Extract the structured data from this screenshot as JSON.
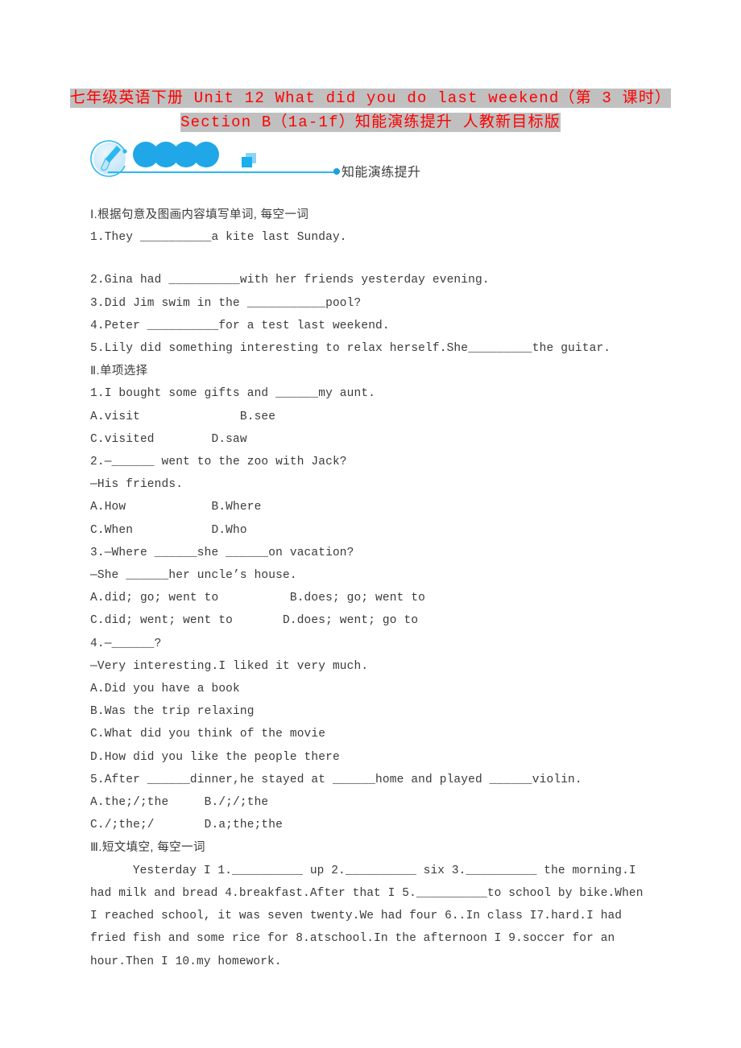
{
  "title": {
    "line1": "七年级英语下册 Unit 12 What did you do last weekend（第 3 课时）",
    "line2": "Section B（1a-1f）知能演练提升 人教新目标版"
  },
  "banner": {
    "label": "知能演练提升",
    "accent_color": "#1fa7e8",
    "logo_icon": "brush-in-circle-icon"
  },
  "sections": [
    {
      "heading": "Ⅰ.根据句意及图画内容填写单词, 每空一词",
      "items": [
        "1.They __________a kite last Sunday.",
        "2.Gina had __________with her friends yesterday evening.",
        "3.Did Jim swim in the ___________pool?",
        "4.Peter __________for a test last weekend.",
        "5.Lily did something interesting to relax herself.She_________the guitar."
      ]
    },
    {
      "heading": "Ⅱ.单项选择",
      "items": [
        "1.I bought some gifts and ______my aunt.",
        "A.visit              B.see",
        "C.visited        D.saw",
        "2.—______ went to the zoo with Jack?",
        "—His friends.",
        "A.How            B.Where",
        "C.When           D.Who",
        "3.—Where ______she ______on vacation?",
        "—She ______her uncle’s house.",
        "A.did; go; went to          B.does; go; went to",
        "C.did; went; went to       D.does; went; go to",
        "4.—______?",
        "—Very interesting.I liked it very much.",
        "A.Did you have a book",
        "B.Was the trip relaxing",
        "C.What did you think of the movie",
        "D.How did you like the people there",
        "5.After ______dinner,he stayed at ______home and played ______violin.",
        "A.the;/;the     B./;/;the",
        "C./;the;/       D.a;the;the"
      ]
    },
    {
      "heading": "Ⅲ.短文填空, 每空一词",
      "passage": "      Yesterday I 1.__________ up 2.__________ six 3.__________ the morning.I had milk and bread 4.breakfast.After that I 5.__________to school by bike.When I reached school, it was seven twenty.We had four 6..In class I7.hard.I had fried fish and some rice for 8.atschool.In the afternoon I 9.soccer for an hour.Then I 10.my homework."
    }
  ]
}
